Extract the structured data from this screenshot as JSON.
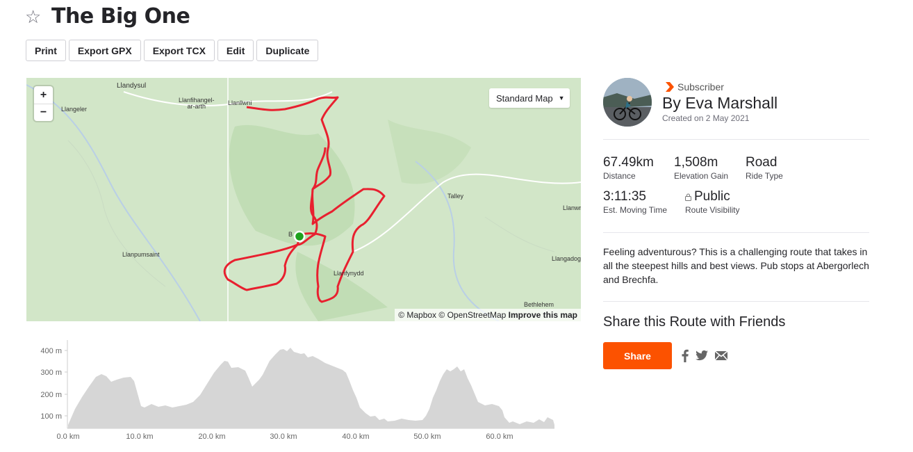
{
  "route": {
    "title": "The Big One"
  },
  "toolbar": {
    "print": "Print",
    "export_gpx": "Export GPX",
    "export_tcx": "Export TCX",
    "edit": "Edit",
    "duplicate": "Duplicate"
  },
  "map": {
    "zoom_in": "+",
    "zoom_out": "−",
    "style_select": "Standard Map",
    "attribution": {
      "mapbox": "© Mapbox",
      "osm": "© OpenStreetMap",
      "improve": "Improve this map"
    },
    "places": {
      "llandysul": "Llandysul",
      "llangeler": "Llangeler",
      "llanfihangel_1": "Llanfihangel-",
      "llanfihangel_2": "ar-arth",
      "llanllwni": "Llanllwni",
      "talley": "Talley",
      "llanwrda": "Llanwr",
      "llanpumsaint": "Llanpumsaint",
      "brechfa": "B",
      "llanfynydd": "Llanfynydd",
      "llangadog": "Llangadog",
      "bethlehem": "Bethlehem"
    }
  },
  "elevation": {
    "y_ticks": [
      "400 m",
      "300 m",
      "200 m",
      "100 m"
    ],
    "x_ticks": [
      "0.0 km",
      "10.0 km",
      "20.0 km",
      "30.0 km",
      "40.0 km",
      "50.0 km",
      "60.0 km"
    ]
  },
  "athlete": {
    "badge": "Subscriber",
    "name": "By Eva Marshall",
    "created": "Created on 2 May 2021"
  },
  "stats": {
    "distance": {
      "value": "67.49km",
      "label": "Distance"
    },
    "elevation": {
      "value": "1,508m",
      "label": "Elevation Gain"
    },
    "type": {
      "value": "Road",
      "label": "Ride Type"
    },
    "time": {
      "value": "3:11:35",
      "label": "Est. Moving Time"
    },
    "visibility": {
      "value": "Public",
      "label": "Route Visibility"
    }
  },
  "description": "Feeling adventurous? This is a challenging route that takes in all the steepest hills and best views. Pub stops at Abergorlech and Brechfa.",
  "share": {
    "title": "Share this Route with Friends",
    "button": "Share"
  },
  "colors": {
    "accent": "#fc5200",
    "route": "#e8202f",
    "start_marker": "#1ea21e"
  },
  "icons": [
    "star-icon",
    "caret-down-icon",
    "subscriber-chevron-icon",
    "lock-icon",
    "facebook-icon",
    "twitter-icon",
    "email-icon"
  ]
}
